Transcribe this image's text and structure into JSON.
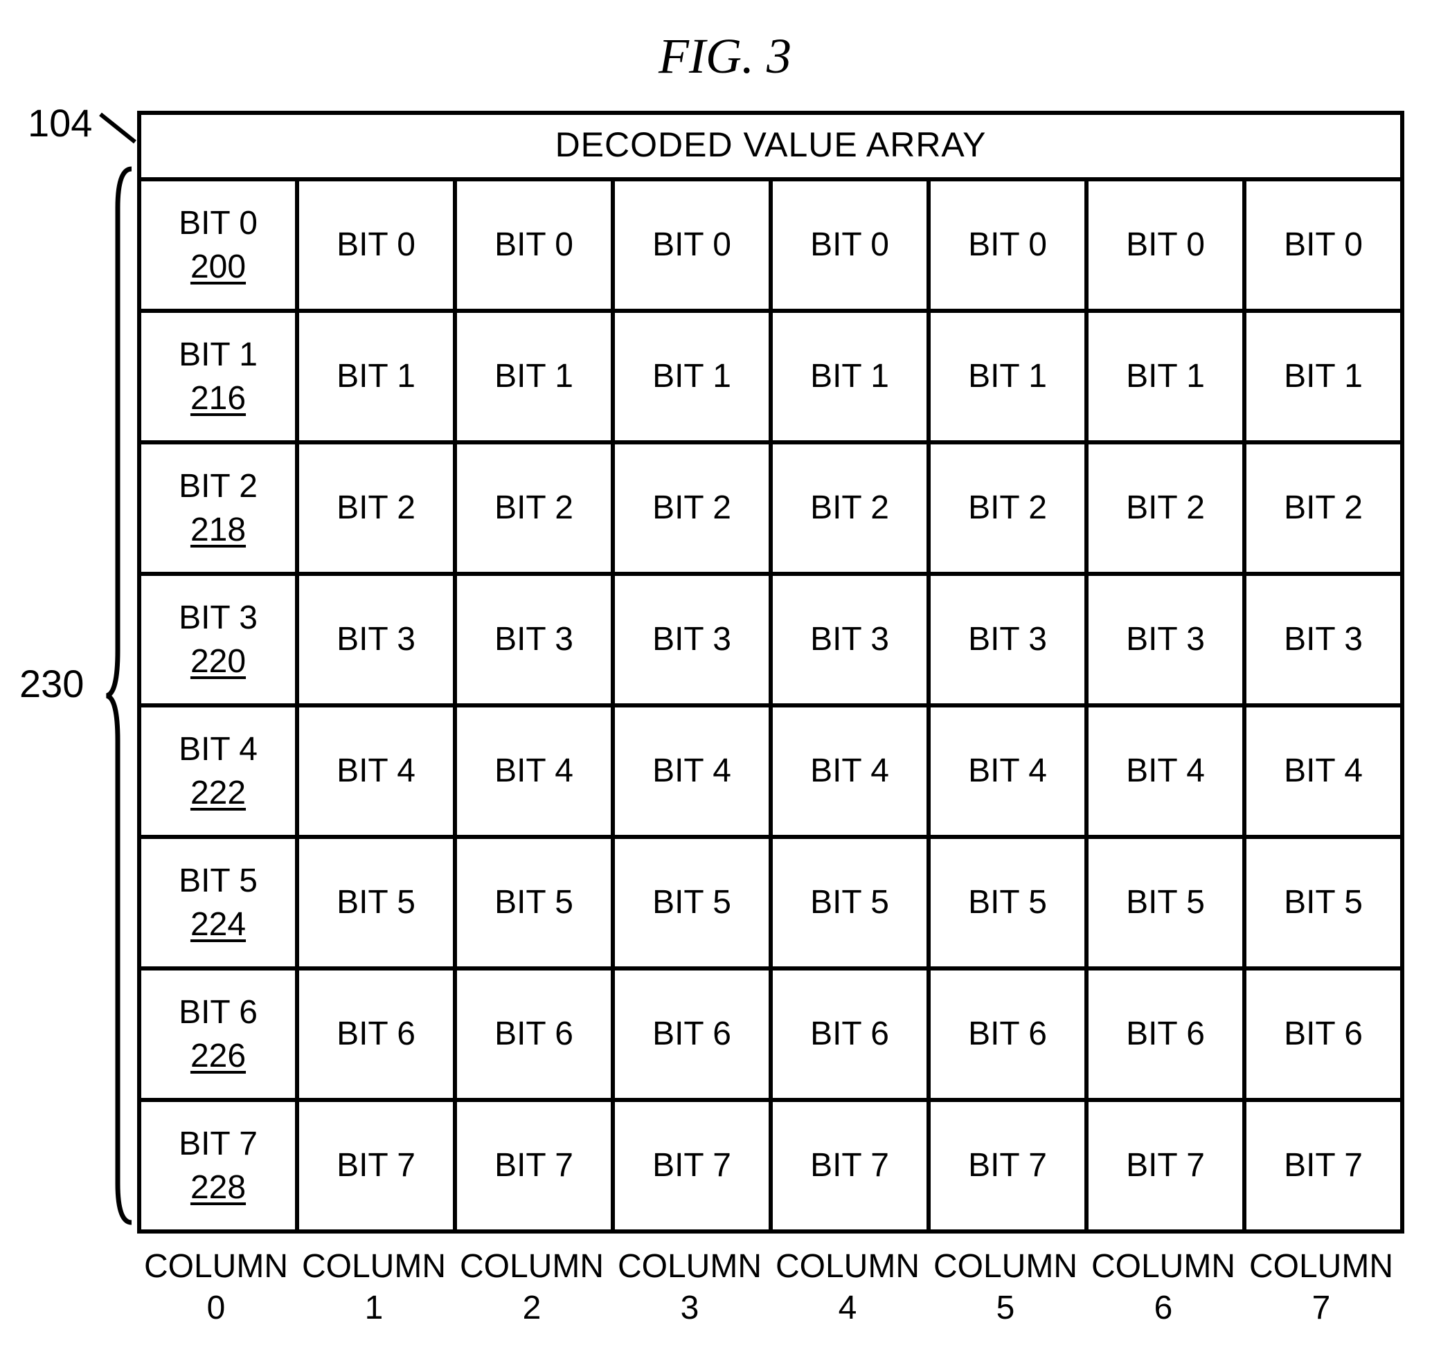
{
  "figure_title": "FIG. 3",
  "ref_104": "104",
  "ref_230": "230",
  "table_header": "DECODED VALUE ARRAY",
  "rows": [
    {
      "bit": "BIT 0",
      "ref": "200"
    },
    {
      "bit": "BIT 1",
      "ref": "216"
    },
    {
      "bit": "BIT 2",
      "ref": "218"
    },
    {
      "bit": "BIT 3",
      "ref": "220"
    },
    {
      "bit": "BIT 4",
      "ref": "222"
    },
    {
      "bit": "BIT 5",
      "ref": "224"
    },
    {
      "bit": "BIT 6",
      "ref": "226"
    },
    {
      "bit": "BIT 7",
      "ref": "228"
    }
  ],
  "columns": [
    {
      "line1": "COLUMN",
      "line2": "0"
    },
    {
      "line1": "COLUMN",
      "line2": "1"
    },
    {
      "line1": "COLUMN",
      "line2": "2"
    },
    {
      "line1": "COLUMN",
      "line2": "3"
    },
    {
      "line1": "COLUMN",
      "line2": "4"
    },
    {
      "line1": "COLUMN",
      "line2": "5"
    },
    {
      "line1": "COLUMN",
      "line2": "6"
    },
    {
      "line1": "COLUMN",
      "line2": "7"
    }
  ],
  "chart_data": {
    "type": "table",
    "title": "DECODED VALUE ARRAY",
    "num_rows": 8,
    "num_cols": 8,
    "row_bit_labels": [
      "BIT 0",
      "BIT 1",
      "BIT 2",
      "BIT 3",
      "BIT 4",
      "BIT 5",
      "BIT 6",
      "BIT 7"
    ],
    "row_reference_numbers_column0": [
      200,
      216,
      218,
      220,
      222,
      224,
      226,
      228
    ],
    "column_labels": [
      "COLUMN 0",
      "COLUMN 1",
      "COLUMN 2",
      "COLUMN 3",
      "COLUMN 4",
      "COLUMN 5",
      "COLUMN 6",
      "COLUMN 7"
    ],
    "outer_reference": 104,
    "row_group_reference": 230,
    "note": "Each cell in every column shows the bit label of its row; only Column 0 cells additionally show an underlined reference number."
  }
}
